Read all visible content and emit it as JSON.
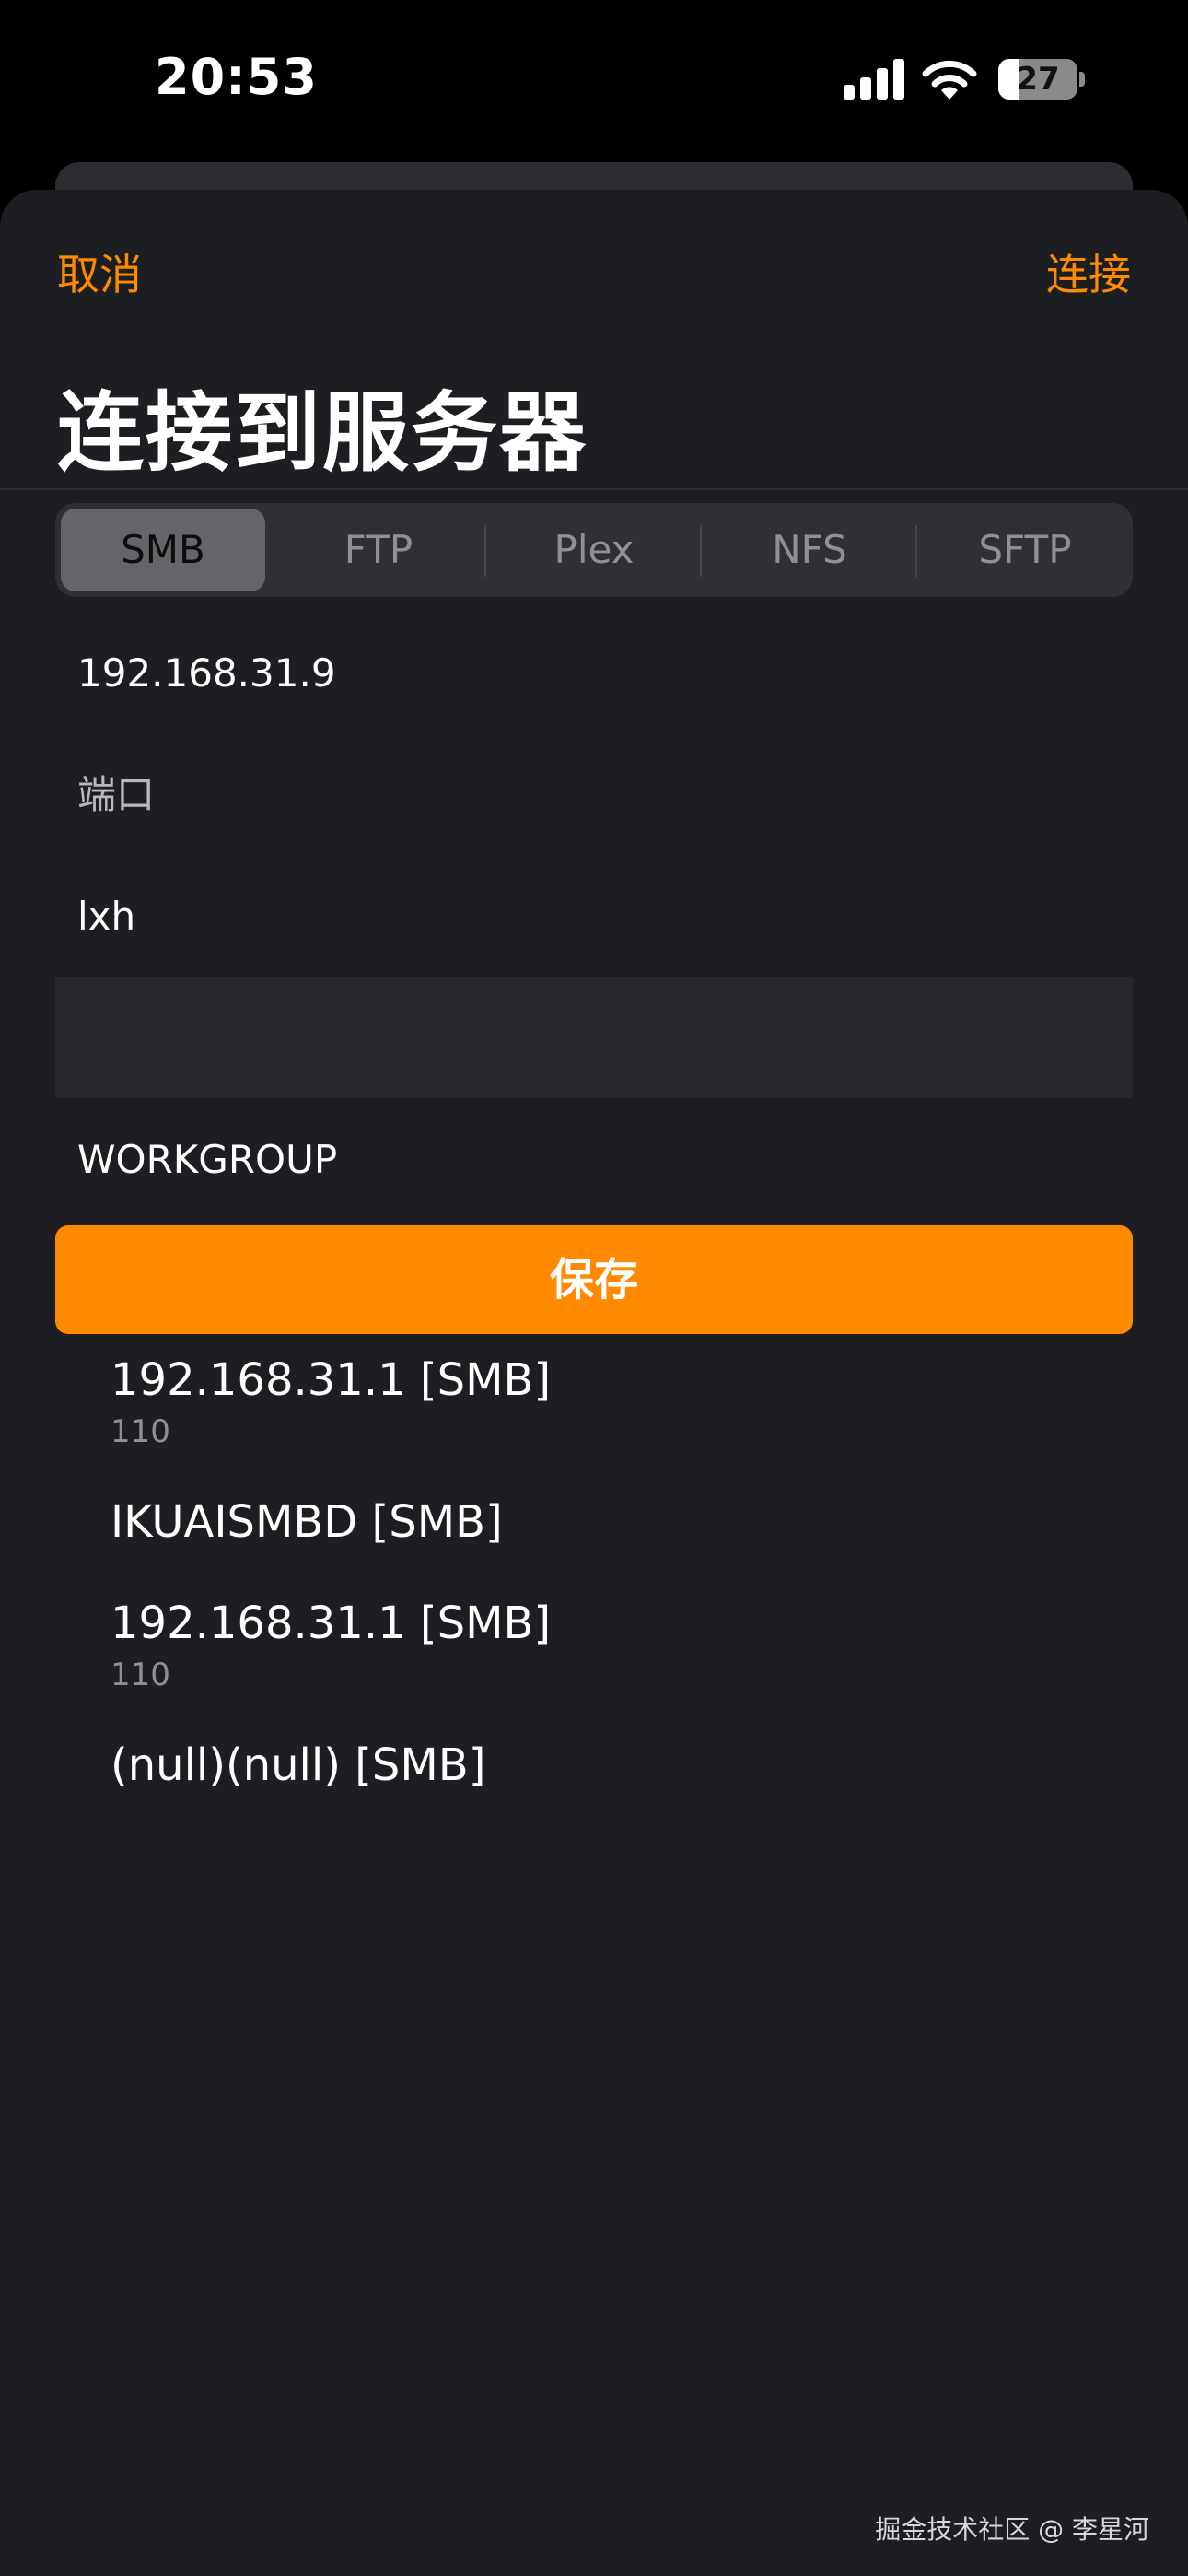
{
  "status_bar": {
    "time": "20:53",
    "battery_level": "27",
    "battery_fraction": 0.27,
    "icons": [
      "cellular-signal-icon",
      "wifi-icon",
      "battery-icon"
    ]
  },
  "nav": {
    "cancel_label": "取消",
    "connect_label": "连接"
  },
  "title": "连接到服务器",
  "protocols": [
    {
      "label": "SMB",
      "selected": true
    },
    {
      "label": "FTP",
      "selected": false
    },
    {
      "label": "Plex",
      "selected": false
    },
    {
      "label": "NFS",
      "selected": false
    },
    {
      "label": "SFTP",
      "selected": false
    }
  ],
  "form": {
    "host_value": "192.168.31.9",
    "port_placeholder": "端口",
    "username_value": "lxh",
    "password_value": "",
    "workgroup_value": "WORKGROUP"
  },
  "save_label": "保存",
  "servers": [
    {
      "name": "192.168.31.1 [SMB]",
      "sub": "110"
    },
    {
      "name": "IKUAISMBD [SMB]",
      "sub": ""
    },
    {
      "name": "192.168.31.1 [SMB]",
      "sub": "110"
    },
    {
      "name": "(null)(null) [SMB]",
      "sub": ""
    }
  ],
  "watermark": "掘金技术社区 @ 李星河",
  "colors": {
    "accent": "#ff8a00",
    "background": "#1c1e21",
    "segment_bg": "#2e3034",
    "segment_active": "#636568"
  }
}
